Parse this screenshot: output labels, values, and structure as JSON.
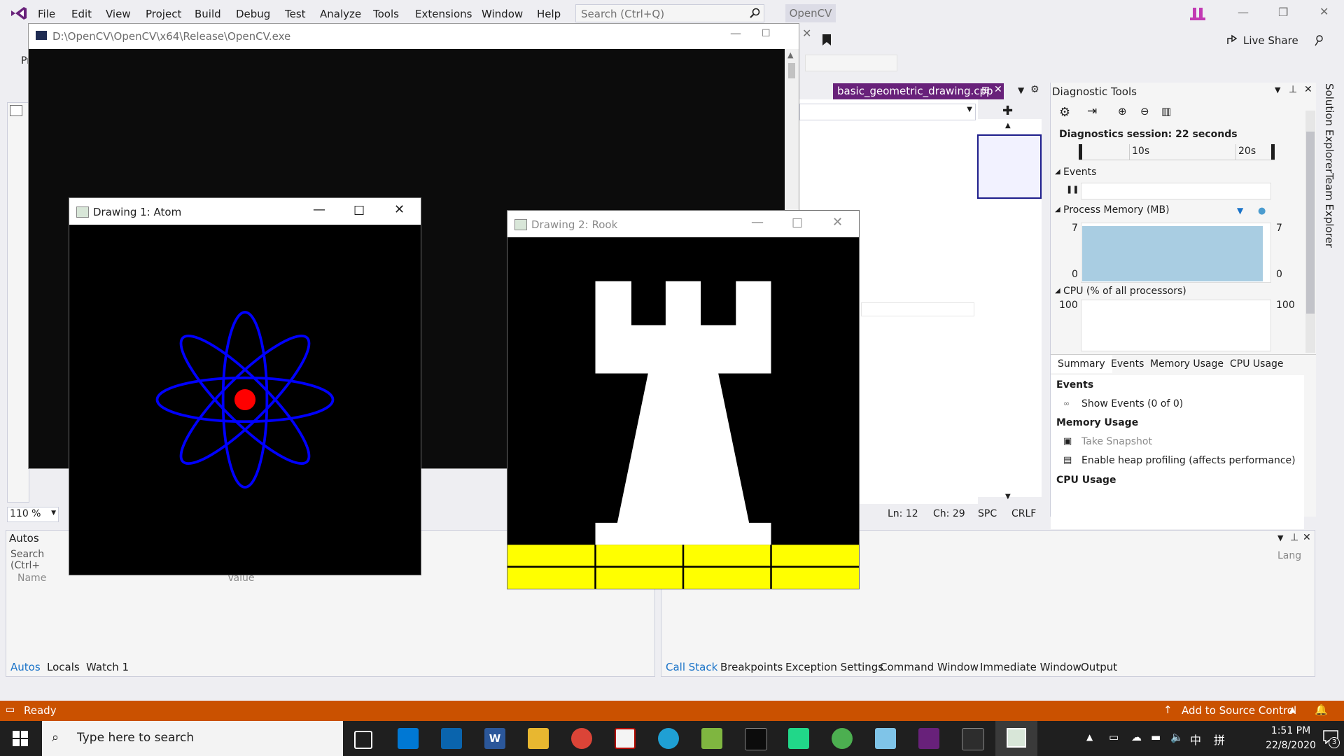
{
  "menu": {
    "items": [
      "File",
      "Edit",
      "View",
      "Project",
      "Build",
      "Debug",
      "Test",
      "Analyze",
      "Tools",
      "Extensions",
      "Window",
      "Help"
    ],
    "search_placeholder": "Search (Ctrl+Q)",
    "solution_name": "OpenCV",
    "live_share": "Live Share"
  },
  "toolbar": {
    "left_text": "Pr"
  },
  "editor": {
    "tab_label": "basic_geometric_drawing.cpp",
    "zoom": "110 %",
    "status": {
      "ln": "Ln: 12",
      "ch": "Ch: 29",
      "spc": "SPC",
      "crlf": "CRLF"
    }
  },
  "diagnostics": {
    "title": "Diagnostic Tools",
    "session": "Diagnostics session: 22 seconds",
    "timeline_ticks": [
      "10s",
      "20s"
    ],
    "events_label": "Events",
    "memory_label": "Process Memory (MB)",
    "memory_max": "7",
    "memory_min": "0",
    "cpu_label": "CPU (% of all processors)",
    "cpu_max": "100",
    "tabs": [
      "Summary",
      "Events",
      "Memory Usage",
      "CPU Usage"
    ],
    "section_events": "Events",
    "show_events": "Show Events (0 of 0)",
    "section_memory": "Memory Usage",
    "take_snapshot": "Take Snapshot",
    "heap_profiling": "Enable heap profiling (affects performance)",
    "section_cpu": "CPU Usage"
  },
  "right_rail": {
    "solution_explorer": "Solution Explorer",
    "team_explorer": "Team Explorer"
  },
  "autos": {
    "title": "Autos",
    "search_placeholder": "Search (Ctrl+",
    "col_name": "Name",
    "col_value": "Value",
    "tabs": [
      "Autos",
      "Locals",
      "Watch 1"
    ]
  },
  "callstack": {
    "col_lang": "Lang",
    "tabs": [
      "Call Stack",
      "Breakpoints",
      "Exception Settings",
      "Command Window",
      "Immediate Window",
      "Output"
    ]
  },
  "statusbar": {
    "ready": "Ready",
    "source_control": "Add to Source Control"
  },
  "console": {
    "title": "D:\\OpenCV\\OpenCV\\x64\\Release\\OpenCV.exe"
  },
  "cv_windows": {
    "atom_title": "Drawing 1: Atom",
    "rook_title": "Drawing 2: Rook"
  },
  "taskbar": {
    "search_placeholder": "Type here to search",
    "time": "1:51 PM",
    "date": "22/8/2020",
    "notification_count": "3",
    "ime": "中"
  },
  "colors": {
    "accent": "#68217a",
    "status_bar": "#ca5100",
    "link_blue": "#1a73c8"
  }
}
